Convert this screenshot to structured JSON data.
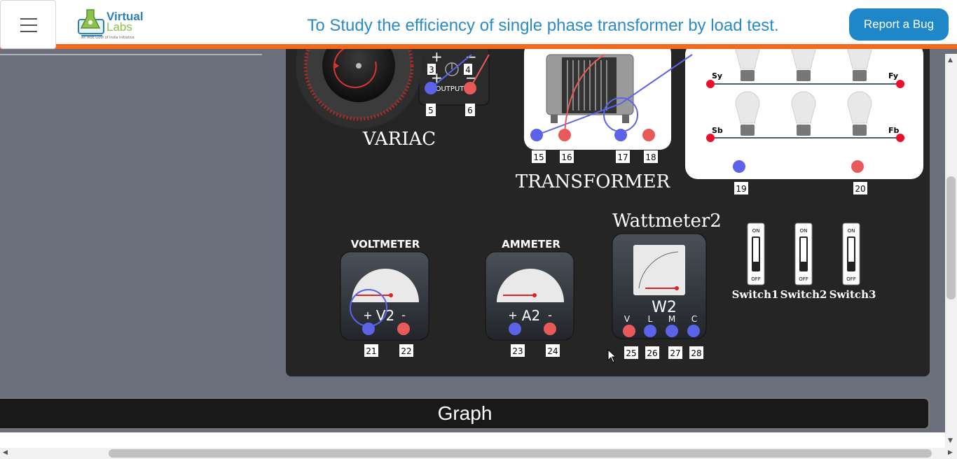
{
  "header": {
    "menu_label": "menu",
    "logo_line1": "Virtual",
    "logo_line2": "Labs",
    "logo_tagline": "An MoE Govt of India Initiative",
    "title": "To Study the efficiency of single phase transformer by load test.",
    "report_bug": "Report a Bug"
  },
  "board": {
    "variac_label": "VARIAC",
    "variac_output_label": "OUTPUT",
    "transformer_label": "TRANSFORMER",
    "wattmeter_label": "Wattmeter2",
    "voltmeter_label": "VOLTMETER",
    "ammeter_label": "AMMETER",
    "voltmeter_id": "V2",
    "ammeter_id": "A2",
    "wattmeter_id": "W2",
    "wattmeter_terminals": [
      "V",
      "L",
      "M",
      "C"
    ],
    "lamp_labels": [
      "Sy",
      "Fy",
      "Sb",
      "Fb"
    ],
    "switches": [
      {
        "label": "Switch1",
        "on": "ON",
        "off": "OFF"
      },
      {
        "label": "Switch2",
        "on": "ON",
        "off": "OFF"
      },
      {
        "label": "Switch3",
        "on": "ON",
        "off": "OFF"
      }
    ],
    "terminal_numbers": [
      "3",
      "4",
      "5",
      "6",
      "15",
      "16",
      "17",
      "18",
      "19",
      "20",
      "21",
      "22",
      "23",
      "24",
      "25",
      "26",
      "27",
      "28"
    ]
  },
  "graph": {
    "label": "Graph"
  },
  "colors": {
    "accent_orange": "#f5691c",
    "title_blue": "#2b8cc4",
    "button_blue": "#1f87c7",
    "terminal_blue": "#5b63e8",
    "terminal_red": "#e85a5a"
  }
}
